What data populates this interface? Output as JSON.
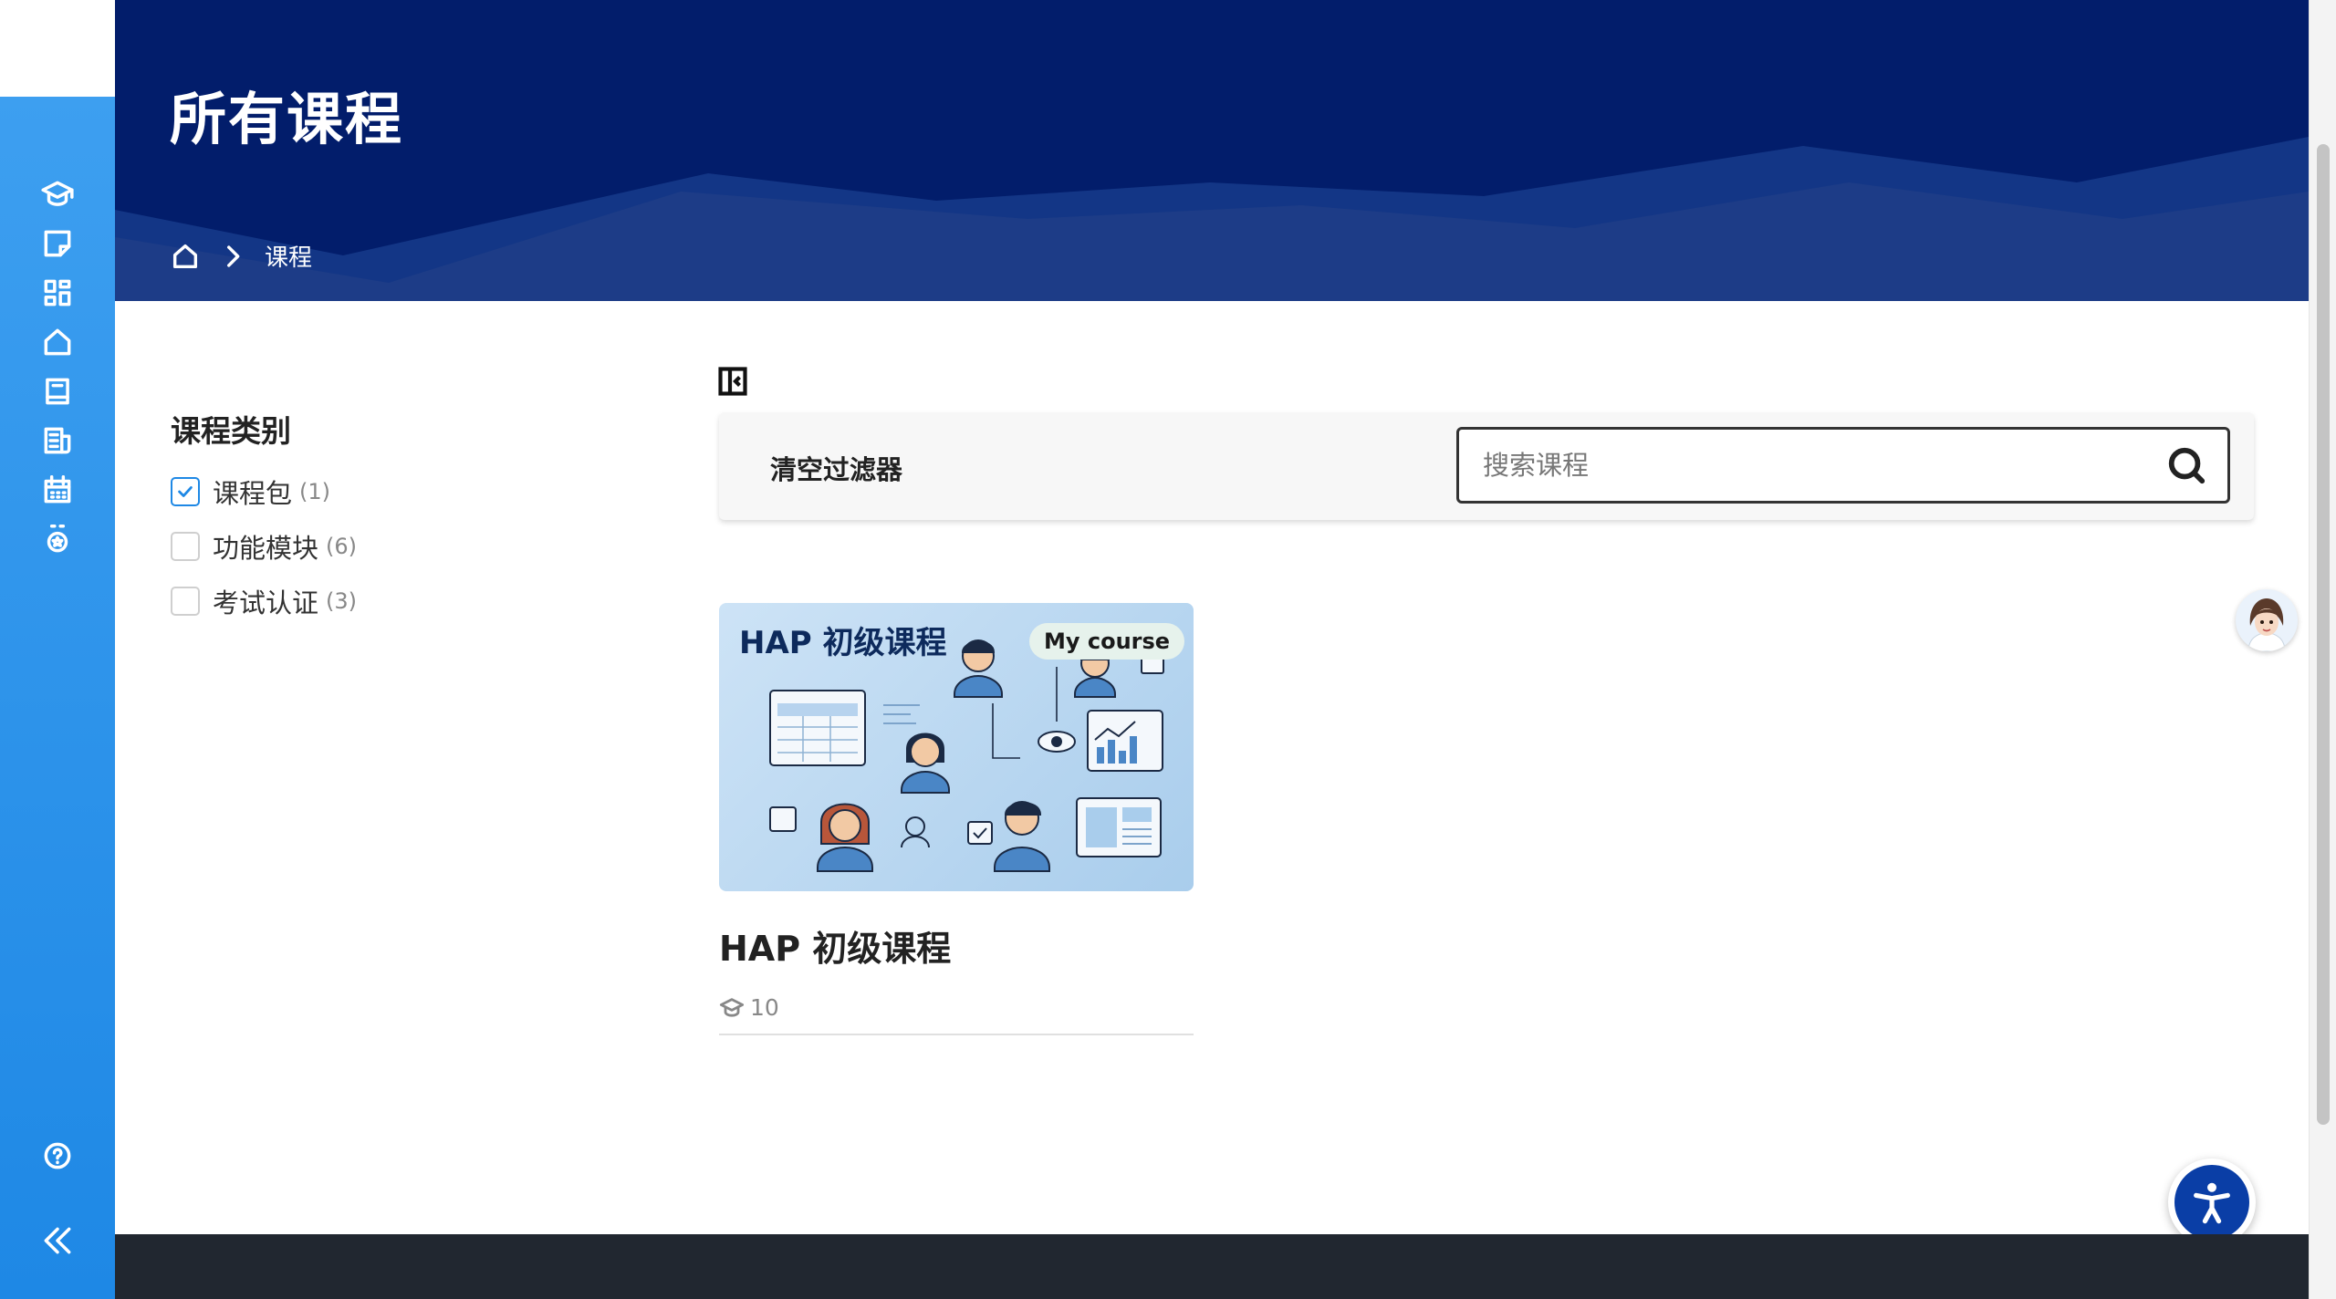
{
  "sidebar": {
    "items": [
      {
        "icon": "graduation-cap-icon"
      },
      {
        "icon": "note-icon"
      },
      {
        "icon": "dashboard-grid-icon"
      },
      {
        "icon": "home-icon"
      },
      {
        "icon": "book-icon"
      },
      {
        "icon": "news-icon"
      },
      {
        "icon": "calendar-icon"
      },
      {
        "icon": "medal-icon"
      }
    ],
    "help_icon": "help-circle-icon",
    "collapse_icon": "double-chevron-left-icon"
  },
  "header": {
    "title": "所有课程",
    "breadcrumb": {
      "home_icon": "home-icon",
      "separator_icon": "chevron-right-icon",
      "current": "课程"
    }
  },
  "filters": {
    "title": "课程类别",
    "options": [
      {
        "label": "课程包",
        "count": "(1)",
        "checked": true
      },
      {
        "label": "功能模块",
        "count": "(6)",
        "checked": false
      },
      {
        "label": "考试认证",
        "count": "(3)",
        "checked": false
      }
    ]
  },
  "toolbar": {
    "clear_filters": "清空过滤器",
    "search_placeholder": "搜索课程",
    "search_value": ""
  },
  "courses": [
    {
      "image_title": "HAP 初级课程",
      "badge": "My course",
      "title": "HAP 初级课程",
      "meta_count": "10"
    }
  ],
  "colors": {
    "sidebar": "#1e88e5",
    "banner": "#021d6b",
    "footer": "#212730",
    "accent": "#1e88e5"
  }
}
